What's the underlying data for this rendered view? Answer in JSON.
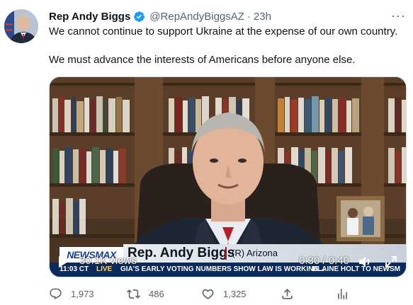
{
  "tweet": {
    "author_name": "Rep Andy Biggs",
    "handle": "@RepAndyBiggsAZ",
    "separator": "·",
    "time": "23h",
    "more": "···",
    "paragraphs": [
      "We cannot continue to support Ukraine at the expense of our own country.",
      "We must advance the interests of Americans before anyone else."
    ]
  },
  "media": {
    "views": "30.1K views",
    "time_display": "0:30 / 0:40",
    "lower_third": {
      "logo": "NEWSMAX",
      "name": "Rep. Andy Biggs",
      "state": "(R) Arizona",
      "ticker_clock": "11:03 CT",
      "ticker_live": "LIVE",
      "ticker_headline": "GIA'S EARLY VOTING NUMBERS SHOW LAW IS WORKING...",
      "ticker_promo": "BLAINE HOLT TO NEWSM"
    }
  },
  "actions": {
    "replies": "1,973",
    "retweets": "486",
    "likes": "1,325",
    "share": "",
    "analytics": ""
  },
  "colors": {
    "text_primary": "#0f1419",
    "text_secondary": "#536471",
    "verified_blue": "#1d9bf0",
    "border": "#cfd9de"
  },
  "icons": [
    "avatar-photo",
    "verified-badge-icon",
    "more-icon",
    "play-icon",
    "volume-icon",
    "fullscreen-icon",
    "reply-icon",
    "retweet-icon",
    "like-icon",
    "share-icon",
    "analytics-icon"
  ]
}
